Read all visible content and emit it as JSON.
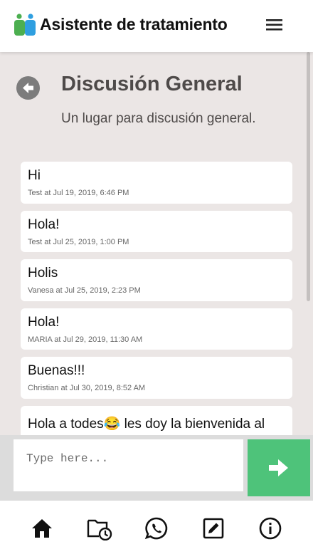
{
  "app": {
    "title": "Asistente de tratamiento"
  },
  "page": {
    "title": "Discusión General",
    "subtitle": "Un lugar para discusión general."
  },
  "messages": [
    {
      "text": "Hi",
      "meta": "Test at Jul 19, 2019, 6:46 PM"
    },
    {
      "text": "Hola!",
      "meta": "Test at Jul 25, 2019, 1:00 PM"
    },
    {
      "text": "Holis",
      "meta": "Vanesa at Jul 25, 2019, 2:23 PM"
    },
    {
      "text": "Hola!",
      "meta": "MARIA at Jul 29, 2019, 11:30 AM"
    },
    {
      "text": "Buenas!!!",
      "meta": "Christian at Jul 30, 2019, 8:52 AM"
    },
    {
      "text": "Hola a todes😂  les doy la bienvenida al",
      "meta": ""
    }
  ],
  "composer": {
    "placeholder": "Type here...",
    "value": ""
  },
  "colors": {
    "accent": "#4ec37a",
    "logo_green": "#4caf50",
    "logo_blue": "#2f9fe0"
  },
  "icons": {
    "menu": "hamburger-menu-icon",
    "back": "arrow-left-icon",
    "send": "arrow-right-icon",
    "nav": [
      "home-icon",
      "folder-clock-icon",
      "whatsapp-icon",
      "edit-icon",
      "info-icon"
    ]
  }
}
